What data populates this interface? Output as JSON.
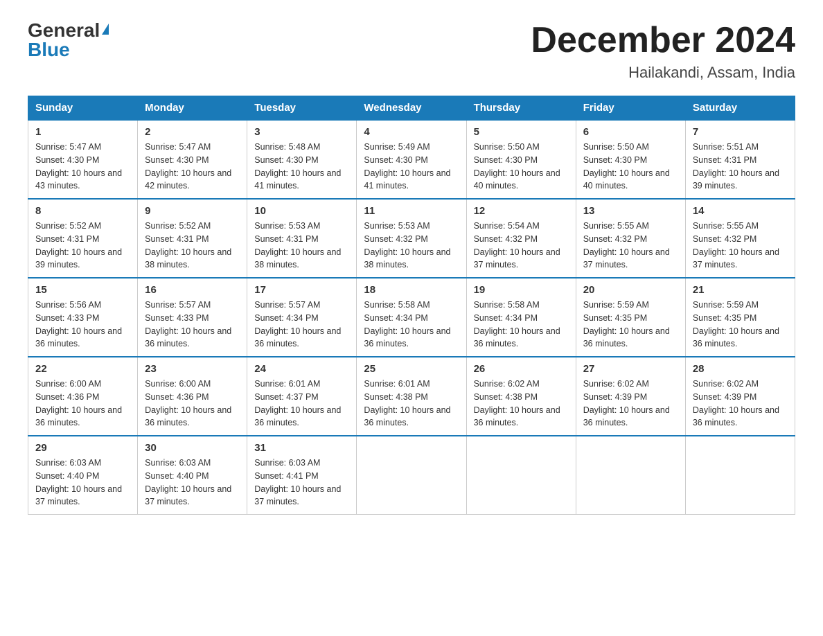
{
  "header": {
    "logo_general": "General",
    "logo_blue": "Blue",
    "month_title": "December 2024",
    "location": "Hailakandi, Assam, India"
  },
  "days_of_week": [
    "Sunday",
    "Monday",
    "Tuesday",
    "Wednesday",
    "Thursday",
    "Friday",
    "Saturday"
  ],
  "weeks": [
    [
      {
        "day": "1",
        "sunrise": "5:47 AM",
        "sunset": "4:30 PM",
        "daylight": "10 hours and 43 minutes."
      },
      {
        "day": "2",
        "sunrise": "5:47 AM",
        "sunset": "4:30 PM",
        "daylight": "10 hours and 42 minutes."
      },
      {
        "day": "3",
        "sunrise": "5:48 AM",
        "sunset": "4:30 PM",
        "daylight": "10 hours and 41 minutes."
      },
      {
        "day": "4",
        "sunrise": "5:49 AM",
        "sunset": "4:30 PM",
        "daylight": "10 hours and 41 minutes."
      },
      {
        "day": "5",
        "sunrise": "5:50 AM",
        "sunset": "4:30 PM",
        "daylight": "10 hours and 40 minutes."
      },
      {
        "day": "6",
        "sunrise": "5:50 AM",
        "sunset": "4:30 PM",
        "daylight": "10 hours and 40 minutes."
      },
      {
        "day": "7",
        "sunrise": "5:51 AM",
        "sunset": "4:31 PM",
        "daylight": "10 hours and 39 minutes."
      }
    ],
    [
      {
        "day": "8",
        "sunrise": "5:52 AM",
        "sunset": "4:31 PM",
        "daylight": "10 hours and 39 minutes."
      },
      {
        "day": "9",
        "sunrise": "5:52 AM",
        "sunset": "4:31 PM",
        "daylight": "10 hours and 38 minutes."
      },
      {
        "day": "10",
        "sunrise": "5:53 AM",
        "sunset": "4:31 PM",
        "daylight": "10 hours and 38 minutes."
      },
      {
        "day": "11",
        "sunrise": "5:53 AM",
        "sunset": "4:32 PM",
        "daylight": "10 hours and 38 minutes."
      },
      {
        "day": "12",
        "sunrise": "5:54 AM",
        "sunset": "4:32 PM",
        "daylight": "10 hours and 37 minutes."
      },
      {
        "day": "13",
        "sunrise": "5:55 AM",
        "sunset": "4:32 PM",
        "daylight": "10 hours and 37 minutes."
      },
      {
        "day": "14",
        "sunrise": "5:55 AM",
        "sunset": "4:32 PM",
        "daylight": "10 hours and 37 minutes."
      }
    ],
    [
      {
        "day": "15",
        "sunrise": "5:56 AM",
        "sunset": "4:33 PM",
        "daylight": "10 hours and 36 minutes."
      },
      {
        "day": "16",
        "sunrise": "5:57 AM",
        "sunset": "4:33 PM",
        "daylight": "10 hours and 36 minutes."
      },
      {
        "day": "17",
        "sunrise": "5:57 AM",
        "sunset": "4:34 PM",
        "daylight": "10 hours and 36 minutes."
      },
      {
        "day": "18",
        "sunrise": "5:58 AM",
        "sunset": "4:34 PM",
        "daylight": "10 hours and 36 minutes."
      },
      {
        "day": "19",
        "sunrise": "5:58 AM",
        "sunset": "4:34 PM",
        "daylight": "10 hours and 36 minutes."
      },
      {
        "day": "20",
        "sunrise": "5:59 AM",
        "sunset": "4:35 PM",
        "daylight": "10 hours and 36 minutes."
      },
      {
        "day": "21",
        "sunrise": "5:59 AM",
        "sunset": "4:35 PM",
        "daylight": "10 hours and 36 minutes."
      }
    ],
    [
      {
        "day": "22",
        "sunrise": "6:00 AM",
        "sunset": "4:36 PM",
        "daylight": "10 hours and 36 minutes."
      },
      {
        "day": "23",
        "sunrise": "6:00 AM",
        "sunset": "4:36 PM",
        "daylight": "10 hours and 36 minutes."
      },
      {
        "day": "24",
        "sunrise": "6:01 AM",
        "sunset": "4:37 PM",
        "daylight": "10 hours and 36 minutes."
      },
      {
        "day": "25",
        "sunrise": "6:01 AM",
        "sunset": "4:38 PM",
        "daylight": "10 hours and 36 minutes."
      },
      {
        "day": "26",
        "sunrise": "6:02 AM",
        "sunset": "4:38 PM",
        "daylight": "10 hours and 36 minutes."
      },
      {
        "day": "27",
        "sunrise": "6:02 AM",
        "sunset": "4:39 PM",
        "daylight": "10 hours and 36 minutes."
      },
      {
        "day": "28",
        "sunrise": "6:02 AM",
        "sunset": "4:39 PM",
        "daylight": "10 hours and 36 minutes."
      }
    ],
    [
      {
        "day": "29",
        "sunrise": "6:03 AM",
        "sunset": "4:40 PM",
        "daylight": "10 hours and 37 minutes."
      },
      {
        "day": "30",
        "sunrise": "6:03 AM",
        "sunset": "4:40 PM",
        "daylight": "10 hours and 37 minutes."
      },
      {
        "day": "31",
        "sunrise": "6:03 AM",
        "sunset": "4:41 PM",
        "daylight": "10 hours and 37 minutes."
      },
      null,
      null,
      null,
      null
    ]
  ]
}
